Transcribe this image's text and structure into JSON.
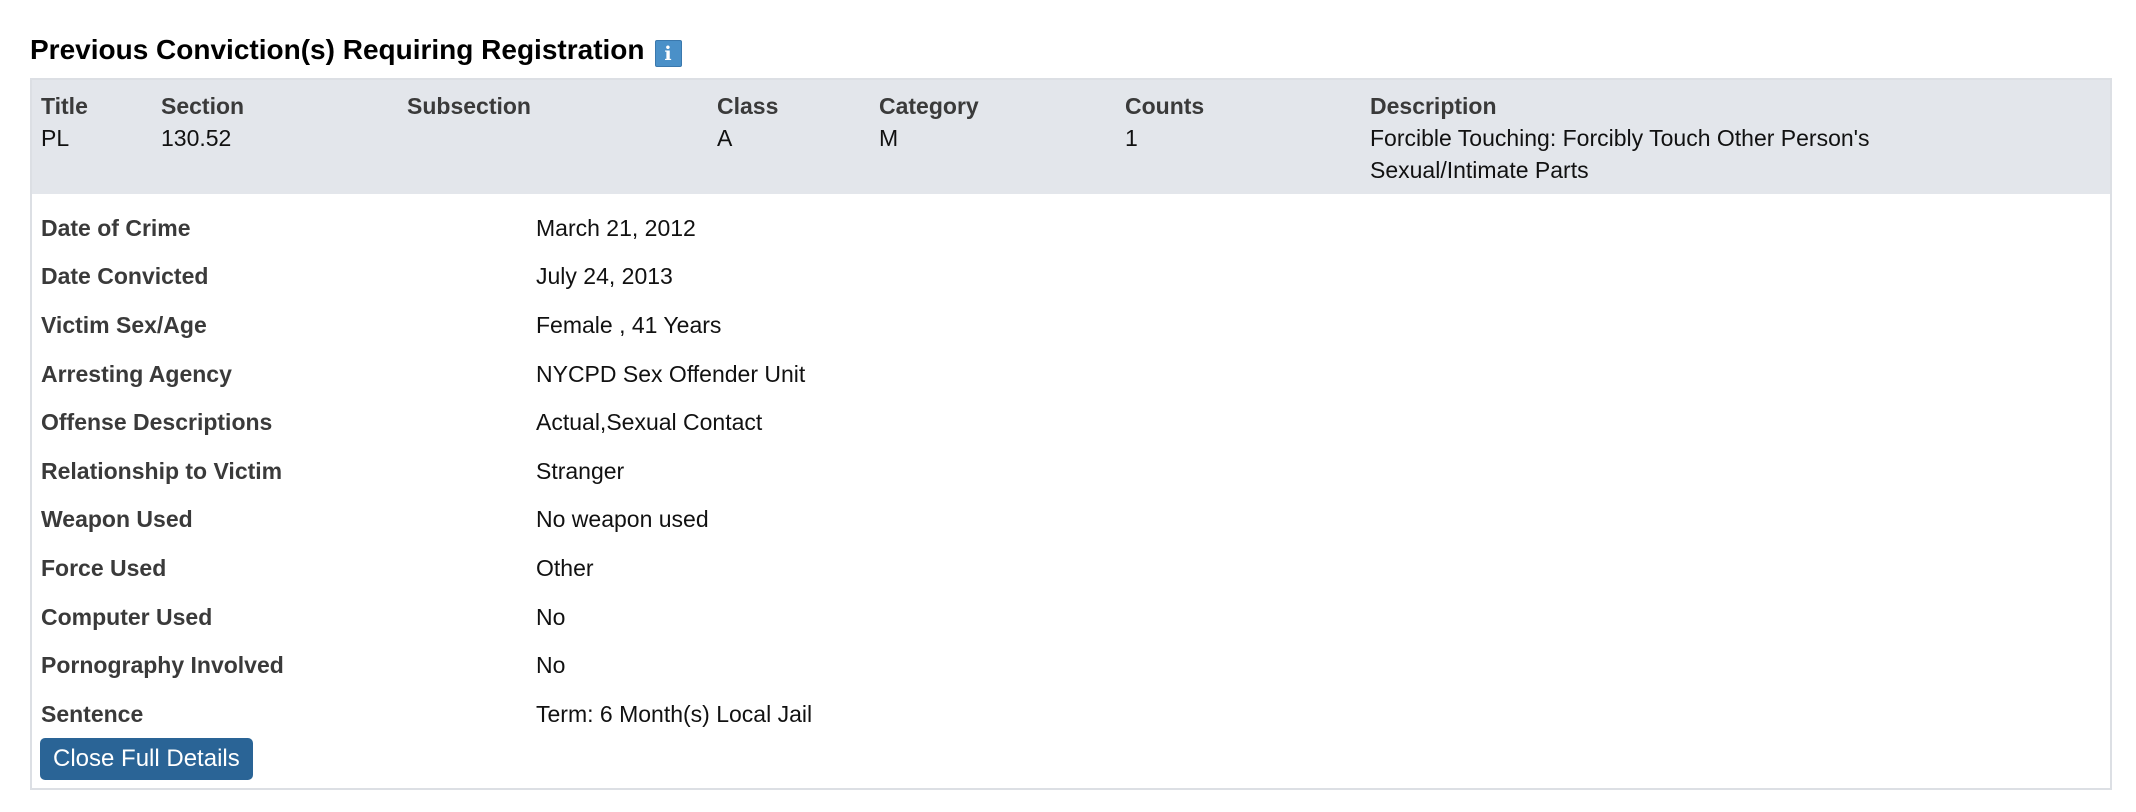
{
  "section": {
    "title": "Previous Conviction(s) Requiring Registration",
    "info_icon": "i"
  },
  "conviction": {
    "headers": {
      "title": "Title",
      "section": "Section",
      "subsection": "Subsection",
      "class": "Class",
      "category": "Category",
      "counts": "Counts",
      "description": "Description"
    },
    "values": {
      "title": "PL",
      "section": "130.52",
      "subsection": "",
      "class": "A",
      "category": "M",
      "counts": "1",
      "description_line1": "Forcible Touching: Forcibly Touch Other Person's",
      "description_line2": "Sexual/Intimate Parts"
    }
  },
  "details": [
    {
      "label": "Date of Crime",
      "value": "March 21, 2012"
    },
    {
      "label": "Date Convicted",
      "value": "July 24, 2013"
    },
    {
      "label": "Victim Sex/Age",
      "value": "Female , 41 Years"
    },
    {
      "label": "Arresting Agency",
      "value": "NYCPD Sex Offender Unit"
    },
    {
      "label": "Offense Descriptions",
      "value": "Actual,Sexual Contact"
    },
    {
      "label": "Relationship to Victim",
      "value": "Stranger"
    },
    {
      "label": "Weapon Used",
      "value": "No weapon used"
    },
    {
      "label": "Force Used",
      "value": "Other"
    },
    {
      "label": "Computer Used",
      "value": "No"
    },
    {
      "label": "Pornography Involved",
      "value": "No"
    },
    {
      "label": "Sentence",
      "value": "Term: 6 Month(s) Local Jail"
    }
  ],
  "actions": {
    "close_label": "Close Full Details"
  },
  "colors": {
    "header_bg": "#e3e6eb",
    "button_bg": "#2a6496",
    "info_icon_bg": "#4a90c8"
  }
}
